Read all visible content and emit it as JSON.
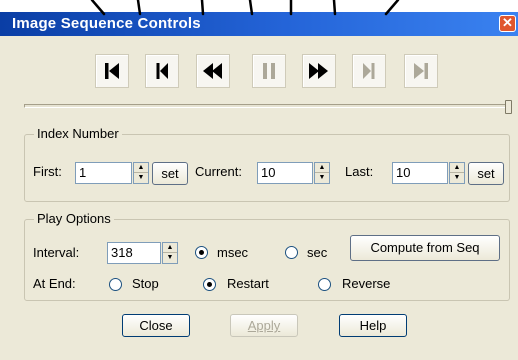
{
  "window": {
    "title": "Image Sequence Controls",
    "close_glyph": "✕"
  },
  "toolbar": [
    {
      "name": "go-first-button",
      "icon": "skip-to-start-icon",
      "enabled": true
    },
    {
      "name": "step-back-button",
      "icon": "step-back-icon",
      "enabled": true
    },
    {
      "name": "play-backward-button",
      "icon": "fast-rewind-icon",
      "enabled": true
    },
    {
      "name": "pause-button",
      "icon": "pause-icon",
      "enabled": false
    },
    {
      "name": "play-forward-button",
      "icon": "fast-forward-icon",
      "enabled": true
    },
    {
      "name": "step-forward-button",
      "icon": "step-forward-icon",
      "enabled": false
    },
    {
      "name": "go-last-button",
      "icon": "skip-to-end-icon",
      "enabled": false
    }
  ],
  "slider": {
    "position_fraction": 1.0
  },
  "index_number": {
    "legend": "Index Number",
    "first_label": "First:",
    "first_value": "1",
    "current_label": "Current:",
    "current_value": "10",
    "last_label": "Last:",
    "last_value": "10",
    "set_label": "set"
  },
  "play_options": {
    "legend": "Play Options",
    "interval_label": "Interval:",
    "interval_value": "318",
    "unit_msec": "msec",
    "unit_sec": "sec",
    "unit_selected": "msec",
    "compute_label": "Compute from Seq",
    "at_end_label": "At End:",
    "at_end_stop": "Stop",
    "at_end_restart": "Restart",
    "at_end_reverse": "Reverse",
    "at_end_selected": "Restart"
  },
  "footer": {
    "close_label": "Close",
    "apply_label": "Apply",
    "help_label": "Help"
  },
  "colors": {
    "title_start": "#0a3ea5",
    "title_end": "#3a82f0",
    "dialog_bg": "#ece9d8",
    "icon_enabled": "#000000",
    "icon_disabled": "#aca899"
  }
}
